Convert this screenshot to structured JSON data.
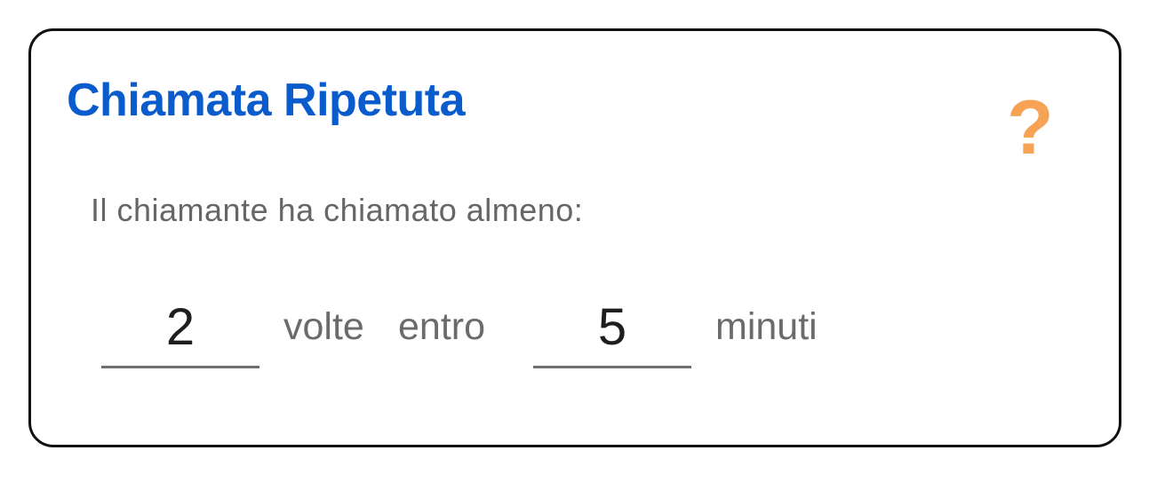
{
  "dialog": {
    "title": "Chiamata Ripetuta",
    "help_icon": "question-mark-icon",
    "help_glyph": "?",
    "description": "Il chiamante ha chiamato almeno:",
    "count_value": "2",
    "times_label": "volte",
    "within_label": "entro",
    "minutes_value": "5",
    "minutes_label": "minuti"
  },
  "colors": {
    "title": "#0a5ccc",
    "help_icon": "#f7a356",
    "border": "#111111",
    "label_text": "#6b6b6b",
    "value_text": "#1e1e1e"
  }
}
